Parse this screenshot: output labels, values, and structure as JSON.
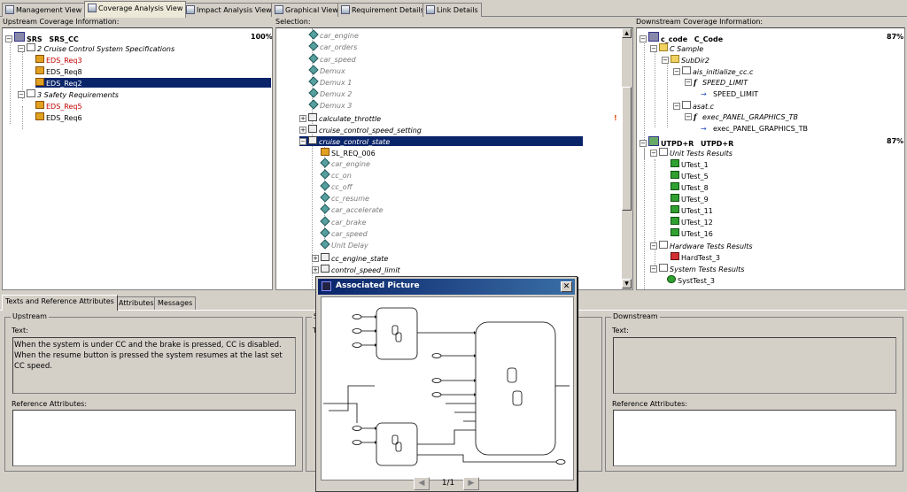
{
  "top_tabs": [
    {
      "label": "Management View",
      "active": false
    },
    {
      "label": "Coverage Analysis View",
      "active": true
    },
    {
      "label": "Impact Analysis View",
      "active": false
    },
    {
      "label": "Graphical View",
      "active": false
    },
    {
      "label": "Requirement Details",
      "active": false
    },
    {
      "label": "Link Details",
      "active": false
    }
  ],
  "upstream": {
    "label": "Upstream Coverage Information:",
    "root": {
      "id": "SRS",
      "name": "SRS_CC",
      "percent": "100%"
    },
    "groups": [
      {
        "label": "2 Cruise Control System Specifications",
        "items": [
          "EDS_Req3",
          "EDS_Req8",
          "EDS_Req2"
        ]
      },
      {
        "label": "3 Safety Requirements",
        "items": [
          "EDS_Req5",
          "EDS_Req6"
        ]
      }
    ]
  },
  "selection": {
    "label": "Selection:",
    "items": [
      "car_engine",
      "car_orders",
      "car_speed",
      "Demux",
      "Demux 1",
      "Demux 2",
      "Demux 3",
      "calculate_throttle",
      "cruise_control_speed_setting",
      "cruise_control_state",
      "SL_REQ_006",
      "car_engine",
      "cc_on",
      "cc_off",
      "cc_resume",
      "car_accelerate",
      "car_brake",
      "car_speed",
      "Unit Delay",
      "cc_engine_state",
      "control_speed_limit"
    ]
  },
  "downstream": {
    "label": "Downstream Coverage Information:",
    "code": {
      "id": "c_code",
      "name": "C_Code",
      "percent": "87%",
      "folder": "C Sample",
      "subfolder": "SubDir2",
      "file1": "ais_initialize_cc.c",
      "func1": "SPEED_LIMIT",
      "ref1": "SPEED_LIMIT",
      "file2": "asat.c",
      "func2": "exec_PANEL_GRAPHICS_TB",
      "ref2": "exec_PANEL_GRAPHICS_TB"
    },
    "tests": {
      "id": "UTPD+R",
      "name": "UTPD+R",
      "percent": "87%",
      "unit_label": "Unit Tests Results",
      "unit": [
        "UTest_1",
        "UTest_5",
        "UTest_8",
        "UTest_9",
        "UTest_11",
        "UTest_12",
        "UTest_16"
      ],
      "hw_label": "Hardware Tests Results",
      "hw": [
        "HardTest_3"
      ],
      "sys_label": "System Tests Results",
      "sys": [
        "SystTest_3"
      ]
    }
  },
  "bottom_tabs": [
    "Texts and Reference Attributes",
    "Attributes",
    "Messages"
  ],
  "upstream_panel": {
    "title": "Upstream",
    "text_label": "Text:",
    "text": "When the system is under CC and the brake is pressed, CC is disabled. When the resume button is pressed the system resumes at the last set CC speed.",
    "ref_label": "Reference Attributes:"
  },
  "selection_panel": {
    "title": "S",
    "text_label": "T"
  },
  "downstream_panel": {
    "title": "Downstream",
    "text_label": "Text:",
    "ref_label": "Reference Attributes:"
  },
  "dialog": {
    "title": "Associated Picture",
    "close": "✕",
    "page": "1/1",
    "prev": "◀",
    "next": "▶"
  }
}
